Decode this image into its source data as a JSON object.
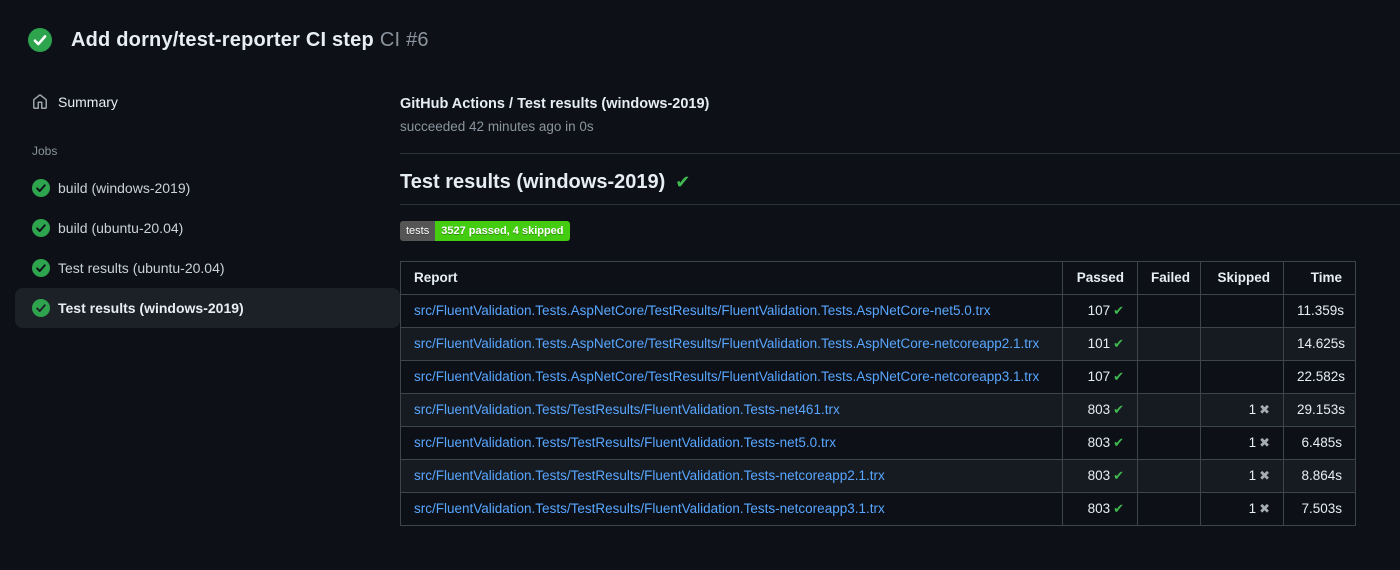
{
  "colors": {
    "success_green": "#2ea44f",
    "check_green": "#3fb950",
    "link_blue": "#58a6ff",
    "selected_item_bg": "#1c2128",
    "badge_label_bg": "#555555",
    "badge_value_bg": "#44cc11"
  },
  "icons": {
    "check": "✔",
    "cross": "✖"
  },
  "run_header": {
    "title": "Add dorny/test-reporter CI step",
    "run_number": "CI #6"
  },
  "sidebar": {
    "summary_label": "Summary",
    "jobs_label": "Jobs",
    "jobs": [
      {
        "label": "build (windows-2019)",
        "status": "success",
        "selected": false
      },
      {
        "label": "build (ubuntu-20.04)",
        "status": "success",
        "selected": false
      },
      {
        "label": "Test results (ubuntu-20.04)",
        "status": "success",
        "selected": false
      },
      {
        "label": "Test results (windows-2019)",
        "status": "success",
        "selected": true
      }
    ]
  },
  "main": {
    "job_title": "GitHub Actions / Test results (windows-2019)",
    "job_status_line": "succeeded 42 minutes ago in 0s",
    "section_heading": "Test results (windows-2019)",
    "badge": {
      "label": "tests",
      "value": "3527 passed, 4 skipped"
    },
    "table": {
      "headers": [
        "Report",
        "Passed",
        "Failed",
        "Skipped",
        "Time"
      ],
      "rows": [
        {
          "report": "src/FluentValidation.Tests.AspNetCore/TestResults/FluentValidation.Tests.AspNetCore-net5.0.trx",
          "passed": "107",
          "failed": "",
          "skipped": "",
          "time": "11.359s"
        },
        {
          "report": "src/FluentValidation.Tests.AspNetCore/TestResults/FluentValidation.Tests.AspNetCore-netcoreapp2.1.trx",
          "passed": "101",
          "failed": "",
          "skipped": "",
          "time": "14.625s"
        },
        {
          "report": "src/FluentValidation.Tests.AspNetCore/TestResults/FluentValidation.Tests.AspNetCore-netcoreapp3.1.trx",
          "passed": "107",
          "failed": "",
          "skipped": "",
          "time": "22.582s"
        },
        {
          "report": "src/FluentValidation.Tests/TestResults/FluentValidation.Tests-net461.trx",
          "passed": "803",
          "failed": "",
          "skipped": "1",
          "time": "29.153s"
        },
        {
          "report": "src/FluentValidation.Tests/TestResults/FluentValidation.Tests-net5.0.trx",
          "passed": "803",
          "failed": "",
          "skipped": "1",
          "time": "6.485s"
        },
        {
          "report": "src/FluentValidation.Tests/TestResults/FluentValidation.Tests-netcoreapp2.1.trx",
          "passed": "803",
          "failed": "",
          "skipped": "1",
          "time": "8.864s"
        },
        {
          "report": "src/FluentValidation.Tests/TestResults/FluentValidation.Tests-netcoreapp3.1.trx",
          "passed": "803",
          "failed": "",
          "skipped": "1",
          "time": "7.503s"
        }
      ]
    }
  }
}
